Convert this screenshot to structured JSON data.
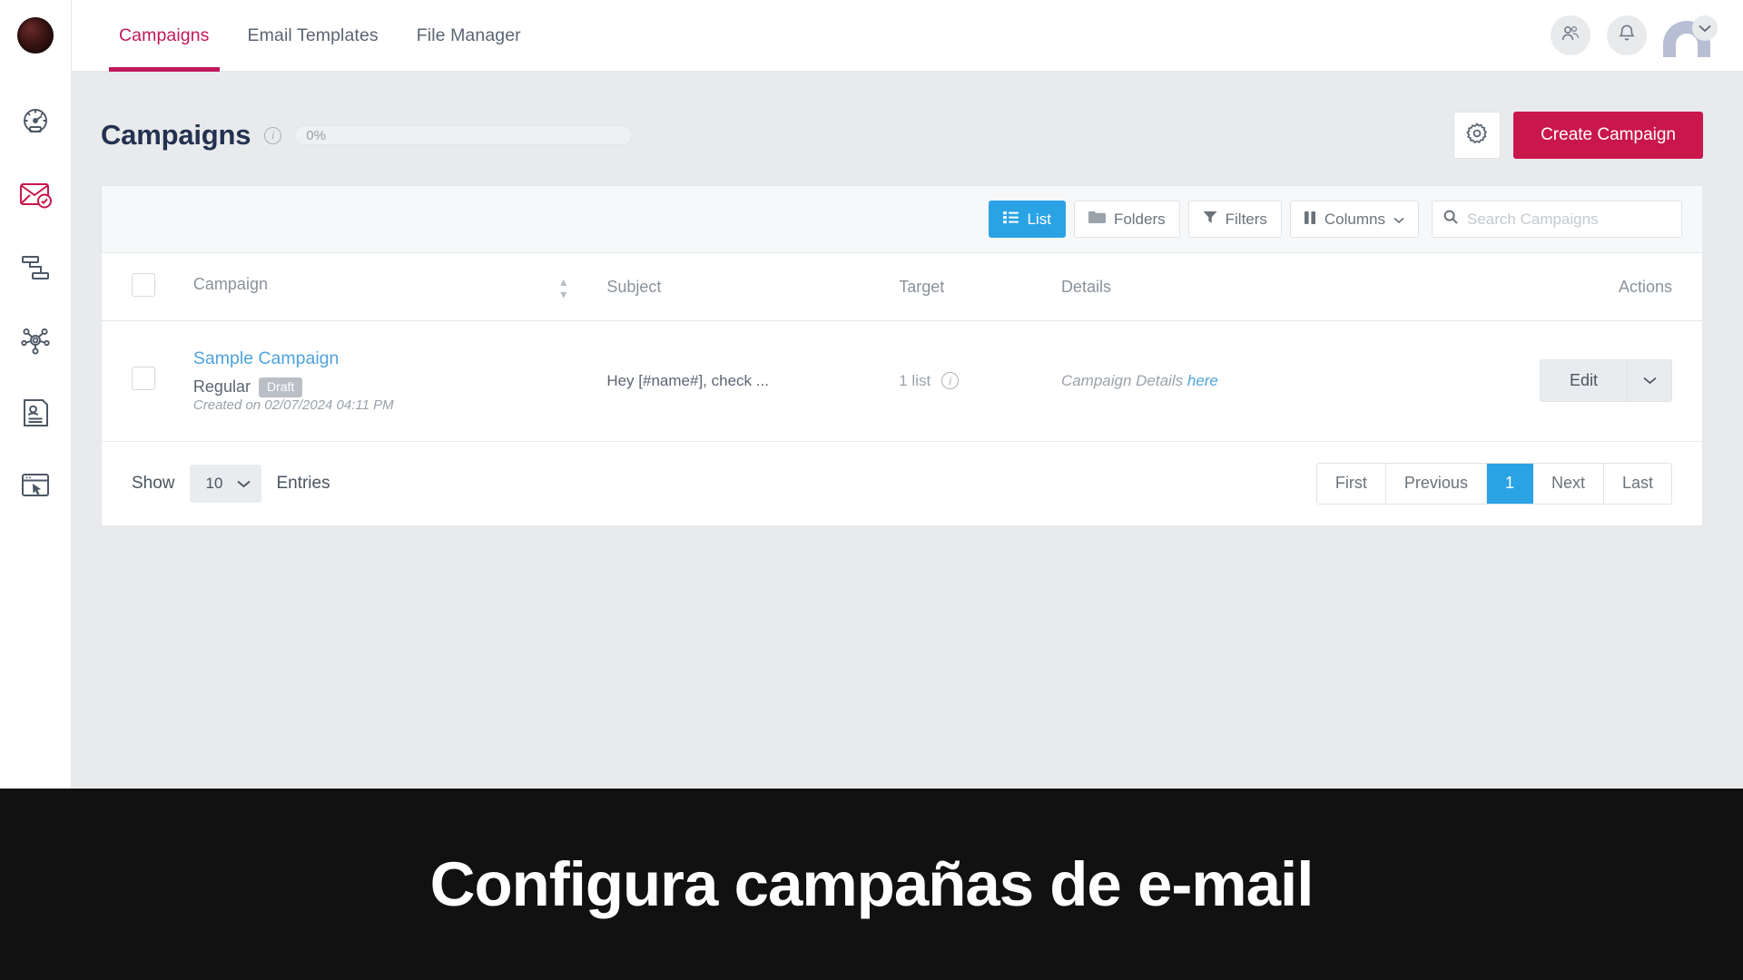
{
  "app": {
    "logo_icon": "app-logo-orb"
  },
  "topnav": {
    "tabs": [
      {
        "label": "Campaigns",
        "active": true
      },
      {
        "label": "Email Templates",
        "active": false
      },
      {
        "label": "File Manager",
        "active": false
      }
    ],
    "icons": {
      "users": "users-icon",
      "bell": "bell-icon",
      "avatar": "avatar",
      "avatar_caret": "chevron-down-icon"
    }
  },
  "sidebar": {
    "items": [
      {
        "icon": "dashboard-gauge-icon",
        "active": false
      },
      {
        "icon": "envelope-check-icon",
        "active": true
      },
      {
        "icon": "sitemap-icon",
        "active": false
      },
      {
        "icon": "network-nodes-icon",
        "active": false
      },
      {
        "icon": "contact-card-icon",
        "active": false
      },
      {
        "icon": "browser-cursor-icon",
        "active": false
      }
    ]
  },
  "header": {
    "title": "Campaigns",
    "info_icon": "info-icon",
    "progress_label": "0%",
    "progress_value": 0,
    "gear_icon": "gear-icon",
    "create_label": "Create Campaign",
    "accent_color": "#c9174b"
  },
  "toolbar": {
    "buttons": [
      {
        "label": "List",
        "icon": "list-icon",
        "active": true
      },
      {
        "label": "Folders",
        "icon": "folder-icon",
        "active": false
      },
      {
        "label": "Filters",
        "icon": "funnel-icon",
        "active": false
      },
      {
        "label": "Columns",
        "icon": "columns-icon",
        "active": false,
        "caret": true
      }
    ],
    "search": {
      "icon": "search-icon",
      "placeholder": "Search Campaigns",
      "value": ""
    },
    "active_color": "#2aa3e5"
  },
  "table": {
    "columns": [
      {
        "key": "checkbox",
        "label": ""
      },
      {
        "key": "campaign",
        "label": "Campaign",
        "sortable": true
      },
      {
        "key": "subject",
        "label": "Subject"
      },
      {
        "key": "target",
        "label": "Target"
      },
      {
        "key": "details",
        "label": "Details"
      },
      {
        "key": "actions",
        "label": "Actions"
      }
    ],
    "rows": [
      {
        "name": "Sample Campaign",
        "type": "Regular",
        "status_badge": "Draft",
        "created": "Created on 02/07/2024 04:11 PM",
        "subject": "Hey [#name#], check ...",
        "target": "1 list",
        "details_text": "Campaign Details",
        "details_link": "here",
        "action_label": "Edit",
        "action_caret_icon": "chevron-down-icon"
      }
    ]
  },
  "footer": {
    "show_label": "Show",
    "entries_value": "10",
    "entries_label": "Entries",
    "pagination": [
      {
        "label": "First",
        "active": false
      },
      {
        "label": "Previous",
        "active": false
      },
      {
        "label": "1",
        "active": true
      },
      {
        "label": "Next",
        "active": false
      },
      {
        "label": "Last",
        "active": false
      }
    ]
  },
  "banner": {
    "text": "Configura campañas de e-mail"
  }
}
